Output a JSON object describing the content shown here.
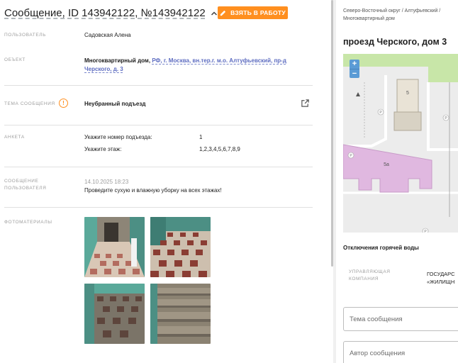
{
  "message": {
    "title": "Сообщение, ID 143942122, №143942122",
    "take_button": "ВЗЯТЬ В РАБОТУ",
    "fields": {
      "user_label": "ПОЛЬЗОВАТЕЛЬ",
      "user_value": "Садовская Алена",
      "object_label": "ОБЪЕКТ",
      "object_type": "Многоквартирный дом,",
      "object_link": "РФ, г. Москва, вн.тер.г. м.о. Алтуфьевский, пр-д Черского, д. 3",
      "topic_label": "ТЕМА СООБЩЕНИЯ",
      "topic_value": "Неубранный подъезд",
      "survey_label": "АНКЕТА",
      "survey": [
        {
          "question": "Укажите номер подъезда:",
          "answer": "1"
        },
        {
          "question": "Укажите этаж:",
          "answer": "1,2,3,4,5,6,7,8,9"
        }
      ],
      "user_msg_label_1": "СООБЩЕНИЕ",
      "user_msg_label_2": "ПОЛЬЗОВАТЕЛЯ",
      "user_msg_date": "14.10.2025 18:23",
      "user_msg_text": "Проведите сухую и влажную уборку на всех этажах!",
      "photos_label": "ФОТОМАТЕРИАЛЫ"
    },
    "photos": [
      "photo-1",
      "photo-2",
      "photo-3",
      "photo-4"
    ]
  },
  "side": {
    "breadcrumb": "Северо-Восточный округ / Алтуфьевский / Многоквартирный дом",
    "address": "проезд Черского, дом 3",
    "map": {
      "zoom_in": "+",
      "zoom_out": "−",
      "building_label_1": "5",
      "building_label_2": "5а",
      "parking_marks": [
        "P",
        "P",
        "P",
        "P"
      ]
    },
    "hot_water_title": "Отключения горячей воды",
    "company_label_1": "УПРАВЛЯЮЩАЯ",
    "company_label_2": "КОМПАНИЯ",
    "company_value_1": "ГОСУДАРС",
    "company_value_2": "«ЖИЛИЩН",
    "topic_input_placeholder": "Тема сообщения",
    "author_input_placeholder": "Автор сообщения"
  },
  "colors": {
    "accent": "#ff8f1f",
    "link": "#5c6bc0",
    "map_green": "#c8e6a8",
    "map_building": "#e0b8e0"
  },
  "icons": [
    "chevron-up-icon",
    "pencil-icon",
    "warning-circle-icon",
    "external-link-icon"
  ]
}
